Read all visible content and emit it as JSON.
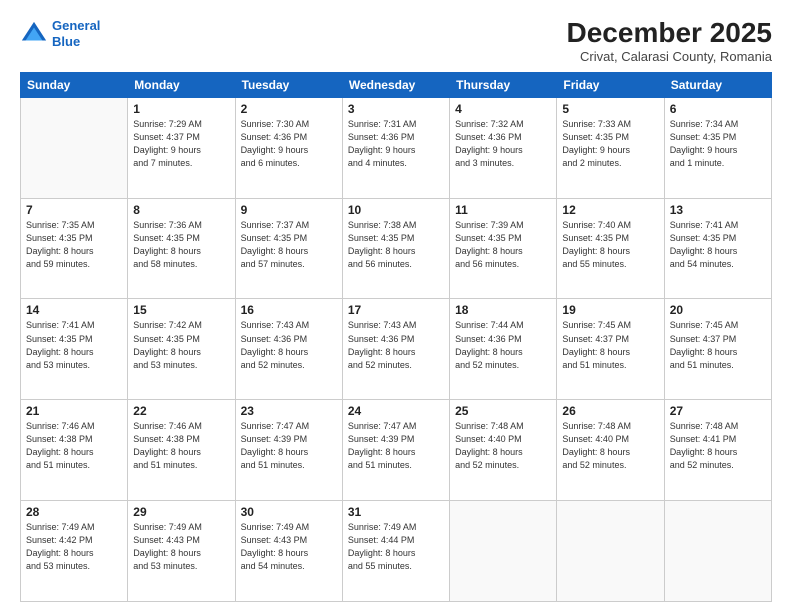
{
  "logo": {
    "line1": "General",
    "line2": "Blue"
  },
  "title": "December 2025",
  "subtitle": "Crivat, Calarasi County, Romania",
  "weekdays": [
    "Sunday",
    "Monday",
    "Tuesday",
    "Wednesday",
    "Thursday",
    "Friday",
    "Saturday"
  ],
  "weeks": [
    [
      {
        "day": "",
        "info": ""
      },
      {
        "day": "1",
        "info": "Sunrise: 7:29 AM\nSunset: 4:37 PM\nDaylight: 9 hours\nand 7 minutes."
      },
      {
        "day": "2",
        "info": "Sunrise: 7:30 AM\nSunset: 4:36 PM\nDaylight: 9 hours\nand 6 minutes."
      },
      {
        "day": "3",
        "info": "Sunrise: 7:31 AM\nSunset: 4:36 PM\nDaylight: 9 hours\nand 4 minutes."
      },
      {
        "day": "4",
        "info": "Sunrise: 7:32 AM\nSunset: 4:36 PM\nDaylight: 9 hours\nand 3 minutes."
      },
      {
        "day": "5",
        "info": "Sunrise: 7:33 AM\nSunset: 4:35 PM\nDaylight: 9 hours\nand 2 minutes."
      },
      {
        "day": "6",
        "info": "Sunrise: 7:34 AM\nSunset: 4:35 PM\nDaylight: 9 hours\nand 1 minute."
      }
    ],
    [
      {
        "day": "7",
        "info": "Sunrise: 7:35 AM\nSunset: 4:35 PM\nDaylight: 8 hours\nand 59 minutes."
      },
      {
        "day": "8",
        "info": "Sunrise: 7:36 AM\nSunset: 4:35 PM\nDaylight: 8 hours\nand 58 minutes."
      },
      {
        "day": "9",
        "info": "Sunrise: 7:37 AM\nSunset: 4:35 PM\nDaylight: 8 hours\nand 57 minutes."
      },
      {
        "day": "10",
        "info": "Sunrise: 7:38 AM\nSunset: 4:35 PM\nDaylight: 8 hours\nand 56 minutes."
      },
      {
        "day": "11",
        "info": "Sunrise: 7:39 AM\nSunset: 4:35 PM\nDaylight: 8 hours\nand 56 minutes."
      },
      {
        "day": "12",
        "info": "Sunrise: 7:40 AM\nSunset: 4:35 PM\nDaylight: 8 hours\nand 55 minutes."
      },
      {
        "day": "13",
        "info": "Sunrise: 7:41 AM\nSunset: 4:35 PM\nDaylight: 8 hours\nand 54 minutes."
      }
    ],
    [
      {
        "day": "14",
        "info": "Sunrise: 7:41 AM\nSunset: 4:35 PM\nDaylight: 8 hours\nand 53 minutes."
      },
      {
        "day": "15",
        "info": "Sunrise: 7:42 AM\nSunset: 4:35 PM\nDaylight: 8 hours\nand 53 minutes."
      },
      {
        "day": "16",
        "info": "Sunrise: 7:43 AM\nSunset: 4:36 PM\nDaylight: 8 hours\nand 52 minutes."
      },
      {
        "day": "17",
        "info": "Sunrise: 7:43 AM\nSunset: 4:36 PM\nDaylight: 8 hours\nand 52 minutes."
      },
      {
        "day": "18",
        "info": "Sunrise: 7:44 AM\nSunset: 4:36 PM\nDaylight: 8 hours\nand 52 minutes."
      },
      {
        "day": "19",
        "info": "Sunrise: 7:45 AM\nSunset: 4:37 PM\nDaylight: 8 hours\nand 51 minutes."
      },
      {
        "day": "20",
        "info": "Sunrise: 7:45 AM\nSunset: 4:37 PM\nDaylight: 8 hours\nand 51 minutes."
      }
    ],
    [
      {
        "day": "21",
        "info": "Sunrise: 7:46 AM\nSunset: 4:38 PM\nDaylight: 8 hours\nand 51 minutes."
      },
      {
        "day": "22",
        "info": "Sunrise: 7:46 AM\nSunset: 4:38 PM\nDaylight: 8 hours\nand 51 minutes."
      },
      {
        "day": "23",
        "info": "Sunrise: 7:47 AM\nSunset: 4:39 PM\nDaylight: 8 hours\nand 51 minutes."
      },
      {
        "day": "24",
        "info": "Sunrise: 7:47 AM\nSunset: 4:39 PM\nDaylight: 8 hours\nand 51 minutes."
      },
      {
        "day": "25",
        "info": "Sunrise: 7:48 AM\nSunset: 4:40 PM\nDaylight: 8 hours\nand 52 minutes."
      },
      {
        "day": "26",
        "info": "Sunrise: 7:48 AM\nSunset: 4:40 PM\nDaylight: 8 hours\nand 52 minutes."
      },
      {
        "day": "27",
        "info": "Sunrise: 7:48 AM\nSunset: 4:41 PM\nDaylight: 8 hours\nand 52 minutes."
      }
    ],
    [
      {
        "day": "28",
        "info": "Sunrise: 7:49 AM\nSunset: 4:42 PM\nDaylight: 8 hours\nand 53 minutes."
      },
      {
        "day": "29",
        "info": "Sunrise: 7:49 AM\nSunset: 4:43 PM\nDaylight: 8 hours\nand 53 minutes."
      },
      {
        "day": "30",
        "info": "Sunrise: 7:49 AM\nSunset: 4:43 PM\nDaylight: 8 hours\nand 54 minutes."
      },
      {
        "day": "31",
        "info": "Sunrise: 7:49 AM\nSunset: 4:44 PM\nDaylight: 8 hours\nand 55 minutes."
      },
      {
        "day": "",
        "info": ""
      },
      {
        "day": "",
        "info": ""
      },
      {
        "day": "",
        "info": ""
      }
    ]
  ]
}
